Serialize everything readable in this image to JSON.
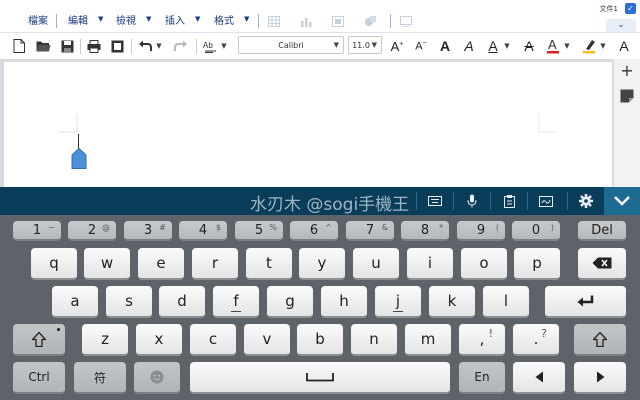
{
  "menubar": {
    "items": [
      {
        "label": "檔案"
      },
      {
        "label": "編輯"
      },
      {
        "label": "檢視"
      },
      {
        "label": "插入"
      },
      {
        "label": "格式"
      }
    ],
    "doc_tab": "文件1",
    "icons": [
      "insert-table-icon",
      "insert-chart-icon",
      "insert-textbox-icon",
      "insert-shape-icon",
      "slide-icon"
    ]
  },
  "toolbar": {
    "font_name": "Calibri",
    "font_size": "11.0",
    "buttons": [
      "new-doc",
      "open",
      "save",
      "print",
      "print-preview",
      "undo",
      "redo",
      "format-painter",
      "increase-font",
      "decrease-font",
      "bold",
      "italic",
      "underline",
      "strikethrough",
      "font-color",
      "highlight",
      "more"
    ],
    "font_color": "#e02020",
    "highlight_color": "#f0c020"
  },
  "keyboard": {
    "watermark": "水刃木 @sogi手機王",
    "top_icons": [
      "keyboard-layout-icon",
      "microphone-icon",
      "clipboard-icon",
      "handwriting-icon",
      "settings-icon",
      "hide-keyboard-icon"
    ],
    "row0": [
      {
        "k": "1",
        "s": "~"
      },
      {
        "k": "2",
        "s": "@"
      },
      {
        "k": "3",
        "s": "#"
      },
      {
        "k": "4",
        "s": "$"
      },
      {
        "k": "5",
        "s": "%"
      },
      {
        "k": "6",
        "s": "^"
      },
      {
        "k": "7",
        "s": "&"
      },
      {
        "k": "8",
        "s": "*"
      },
      {
        "k": "9",
        "s": "("
      },
      {
        "k": "0",
        "s": ")"
      }
    ],
    "del": "Del",
    "row1": [
      "q",
      "w",
      "e",
      "r",
      "t",
      "y",
      "u",
      "i",
      "o",
      "p"
    ],
    "row2": [
      "a",
      "s",
      "d",
      "f",
      "g",
      "h",
      "j",
      "k",
      "l"
    ],
    "row3": [
      "z",
      "x",
      "c",
      "v",
      "b",
      "n",
      "m"
    ],
    "row3_punct": [
      {
        "k": ",",
        "s": "!"
      },
      {
        "k": ".",
        "s": "?"
      }
    ],
    "ctrl": "Ctrl",
    "symbol": "符",
    "lang": "En"
  }
}
